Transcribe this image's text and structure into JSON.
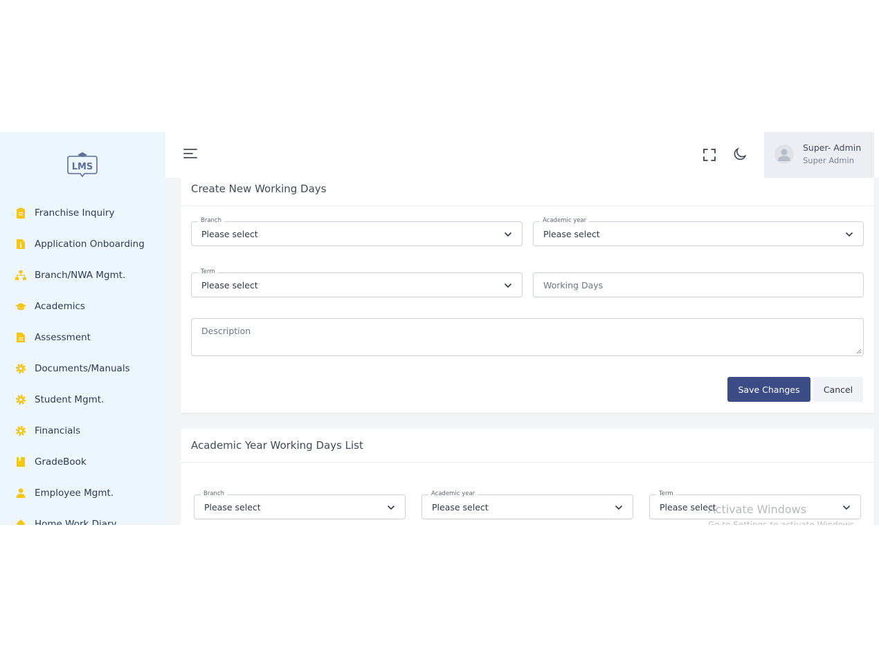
{
  "sidebar": {
    "logo_text": "LMS",
    "accent_color": "#f5c518",
    "items": [
      {
        "label": "Franchise Inquiry",
        "icon": "clipboard-icon"
      },
      {
        "label": "Application Onboarding",
        "icon": "info-document-icon"
      },
      {
        "label": "Branch/NWA Mgmt.",
        "icon": "sitemap-icon"
      },
      {
        "label": "Academics",
        "icon": "graduation-cap-icon"
      },
      {
        "label": "Assessment",
        "icon": "file-icon"
      },
      {
        "label": "Documents/Manuals",
        "icon": "gear-icon"
      },
      {
        "label": "Student Mgmt.",
        "icon": "gear-icon"
      },
      {
        "label": "Financials",
        "icon": "gear-icon"
      },
      {
        "label": "GradeBook",
        "icon": "book-icon"
      },
      {
        "label": "Employee Mgmt.",
        "icon": "user-icon"
      },
      {
        "label": "Home Work Diary",
        "icon": "home-icon"
      }
    ]
  },
  "header": {
    "user_name": "Super- Admin",
    "user_role": "Super Admin"
  },
  "create_form": {
    "title": "Create New Working Days",
    "branch": {
      "label": "Branch",
      "value": "Please select"
    },
    "academic_year": {
      "label": "Academic year",
      "value": "Please select"
    },
    "term": {
      "label": "Term",
      "value": "Please select"
    },
    "working_days": {
      "placeholder": "Working Days"
    },
    "description": {
      "placeholder": "Description"
    },
    "save_label": "Save Changes",
    "cancel_label": "Cancel",
    "primary_color": "#3b4c86"
  },
  "list_section": {
    "title": "Academic Year Working Days List",
    "branch": {
      "label": "Branch",
      "value": "Please select"
    },
    "academic_year": {
      "label": "Academic year",
      "value": "Please select"
    },
    "term": {
      "label": "Term",
      "value": "Please select"
    }
  },
  "watermark": {
    "title": "Activate Windows",
    "subtitle": "Go to Settings to activate Windows."
  }
}
